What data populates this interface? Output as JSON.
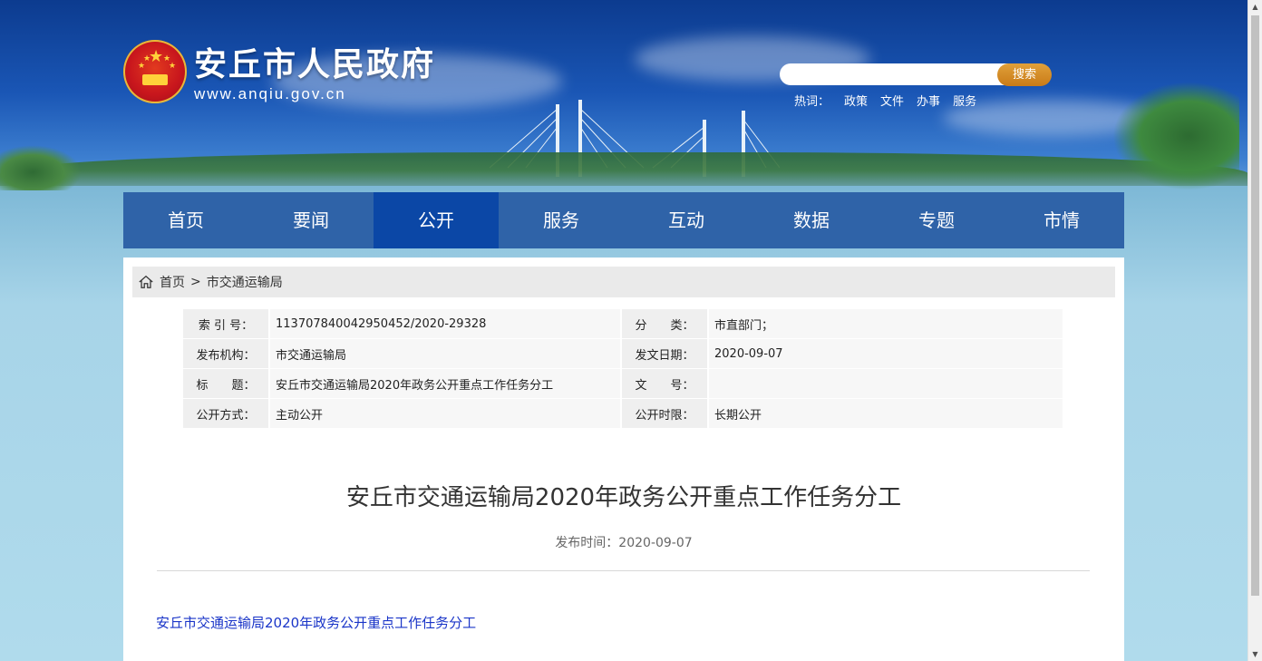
{
  "header": {
    "site_title": "安丘市人民政府",
    "site_url": "www.anqiu.gov.cn",
    "search_placeholder": "",
    "search_button": "搜索",
    "hot_label": "热词：",
    "hot_words": [
      "政策",
      "文件",
      "办事",
      "服务"
    ]
  },
  "nav": {
    "items": [
      "首页",
      "要闻",
      "公开",
      "服务",
      "互动",
      "数据",
      "专题",
      "市情"
    ],
    "active": "公开"
  },
  "breadcrumb": {
    "home": "首页",
    "sep": ">",
    "current": "市交通运输局"
  },
  "meta": {
    "index_label": "索 引 号：",
    "index_value": "113707840042950452/2020-29328",
    "category_label": "分　　类：",
    "category_value": "市直部门；",
    "publisher_label": "发布机构：",
    "publisher_value": "市交通运输局",
    "date_label": "发文日期：",
    "date_value": "2020-09-07",
    "title_label": "标　　题：",
    "title_value": "安丘市交通运输局2020年政务公开重点工作任务分工",
    "docno_label": "文　　号：",
    "docno_value": "",
    "method_label": "公开方式：",
    "method_value": "主动公开",
    "period_label": "公开时限：",
    "period_value": "长期公开"
  },
  "article": {
    "title": "安丘市交通运输局2020年政务公开重点工作任务分工",
    "pubtime": "发布时间：2020-09-07",
    "attachment": "安丘市交通运输局2020年政务公开重点工作任务分工"
  },
  "colors": {
    "nav_bg": "#2f63a8",
    "nav_active": "#0b47a6",
    "search_button": "#d58a22",
    "link": "#1a35c8"
  }
}
